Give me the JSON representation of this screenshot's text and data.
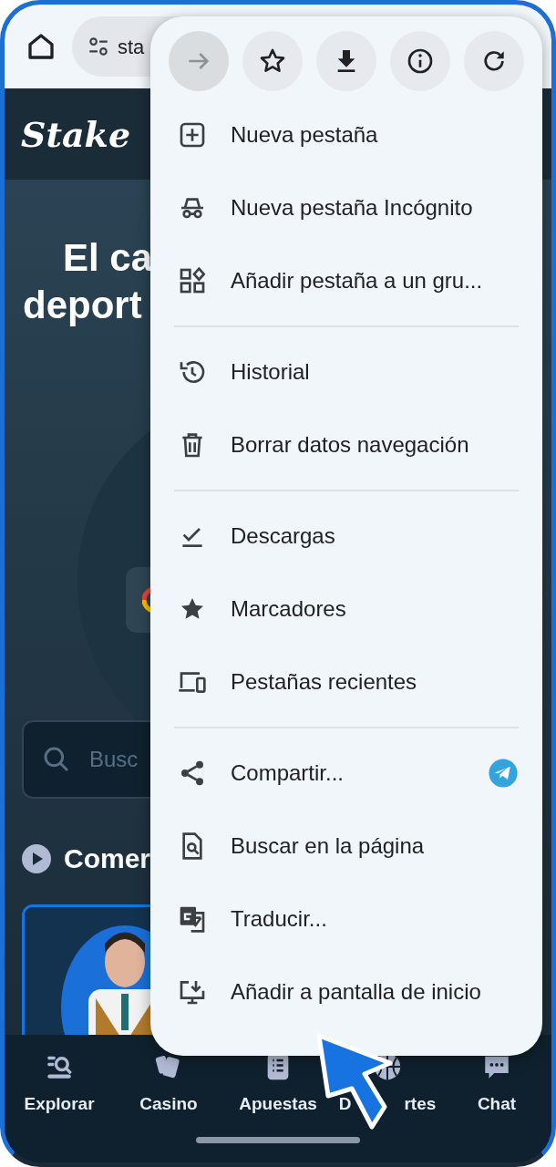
{
  "browser_bar": {
    "url": "sta"
  },
  "site": {
    "logo": "Stake",
    "headline": [
      "El ca",
      "deport"
    ],
    "search": {
      "placeholder": "Busc"
    },
    "section_title": "Comer",
    "nav": [
      {
        "label": "Explorar",
        "kind": "explore"
      },
      {
        "label": "Casino",
        "kind": "cards"
      },
      {
        "label": "Apuestas",
        "kind": "list"
      },
      {
        "label": "D",
        "label_end": "rtes",
        "kind": "ball"
      },
      {
        "label": "Chat",
        "kind": "chat"
      }
    ]
  },
  "menu": {
    "actions": [
      {
        "kind": "forward",
        "disabled": true
      },
      {
        "kind": "star",
        "disabled": false
      },
      {
        "kind": "download",
        "disabled": false
      },
      {
        "kind": "info",
        "disabled": false
      },
      {
        "kind": "reload",
        "disabled": false
      }
    ],
    "groups": [
      [
        {
          "label": "Nueva pestaña",
          "kind": "plus",
          "shortcut_icon": false
        },
        {
          "label": "Nueva pestaña Incógnito",
          "kind": "incognito",
          "shortcut_icon": false
        },
        {
          "label": "Añadir pestaña a un gru...",
          "kind": "group",
          "shortcut_icon": false
        }
      ],
      [
        {
          "label": "Historial",
          "kind": "history",
          "shortcut_icon": false
        },
        {
          "label": "Borrar datos navegación",
          "kind": "trash",
          "shortcut_icon": false
        }
      ],
      [
        {
          "label": "Descargas",
          "kind": "downloads",
          "shortcut_icon": false
        },
        {
          "label": "Marcadores",
          "kind": "star",
          "shortcut_icon": false
        },
        {
          "label": "Pestañas recientes",
          "kind": "devices",
          "shortcut_icon": false
        }
      ],
      [
        {
          "label": "Compartir...",
          "kind": "share",
          "shortcut_icon": true
        },
        {
          "label": "Buscar en la página",
          "kind": "find",
          "shortcut_icon": false
        },
        {
          "label": "Traducir...",
          "kind": "translate",
          "shortcut_icon": false
        },
        {
          "label": "Añadir a pantalla de inicio",
          "kind": "install",
          "shortcut_icon": false
        }
      ]
    ]
  }
}
